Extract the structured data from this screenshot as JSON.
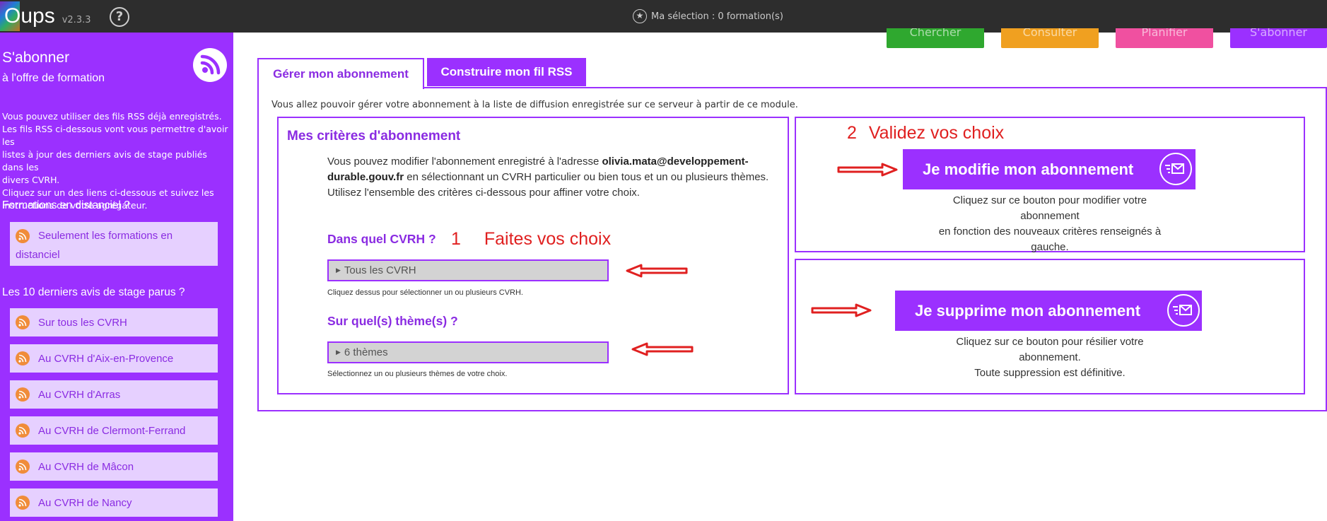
{
  "topbar": {
    "app_name": "Oups",
    "version": "v2.3.3",
    "help_glyph": "?",
    "selection_text": "Ma sélection : 0 formation(s)",
    "buttons": [
      {
        "label": "Chercher",
        "color": "#2fa82f"
      },
      {
        "label": "Consulter",
        "color": "#f0a020"
      },
      {
        "label": "Planifier",
        "color": "#f050a0"
      },
      {
        "label": "S'abonner",
        "color": "#9b30ff"
      }
    ]
  },
  "sidebar": {
    "title": "S'abonner",
    "subtitle": "à l'offre de formation",
    "intro_lines": [
      "Vous pouvez utiliser des fils RSS déjà enregistrés.",
      "Les fils RSS ci-dessous vont vous permettre d'avoir les",
      "listes à jour des derniers avis de stage publiés dans les",
      "divers CVRH.",
      "Cliquez sur un des liens ci-dessous et suivez les",
      "instructions de votre agrégateur."
    ],
    "section_distanciel": "Formations en distanciel ?",
    "item_distanciel_line1": "Seulement les formations en",
    "item_distanciel_line2": "distanciel",
    "section_avis": "Les 10 derniers avis de stage parus ?",
    "items": [
      {
        "label": "Sur tous les CVRH"
      },
      {
        "label": "Au CVRH d'Aix-en-Provence"
      },
      {
        "label": "Au CVRH d'Arras"
      },
      {
        "label": "Au CVRH de Clermont-Ferrand"
      },
      {
        "label": "Au CVRH de Mâcon"
      },
      {
        "label": "Au CVRH de Nancy"
      }
    ]
  },
  "tabs": {
    "active": "Gérer mon abonnement",
    "inactive": "Construire mon fil RSS"
  },
  "main": {
    "intro": "Vous allez pouvoir gérer votre abonnement à la liste de diffusion enregistrée sur ce serveur à partir de ce module.",
    "criteria": {
      "title": "Mes critères d'abonnement",
      "text_before_email": "Vous pouvez modifier l'abonnement enregistré à l'adresse",
      "email_part1": "olivia.mata@developpement-",
      "email_part2": "durable.gouv.fr",
      "text_after_email": "en sélectionnant un CVRH particulier ou bien tous et un ou plusieurs thèmes.",
      "text_line2": "Utilisez l'ensemble des critères ci-dessous pour affiner votre choix.",
      "q_cvrh": "Dans quel CVRH ?",
      "dropdown_cvrh": "Tous les CVRH",
      "hint_cvrh": "Cliquez dessus pour sélectionner un ou plusieurs CVRH.",
      "q_themes": "Sur quel(s) thème(s) ?",
      "dropdown_themes": "6 thèmes",
      "hint_themes": "Sélectionnez un ou plusieurs thèmes de votre choix."
    },
    "modify": {
      "button": "Je modifie mon abonnement",
      "desc_line1": "Cliquez sur ce bouton pour modifier votre abonnement",
      "desc_line2": "en fonction des nouveaux critères renseignés à gauche."
    },
    "delete": {
      "button": "Je supprime mon abonnement",
      "desc_line1": "Cliquez sur ce bouton pour résilier votre abonnement.",
      "desc_line2": "Toute suppression est définitive."
    }
  },
  "annotations": {
    "step1_number": "1",
    "step1_text": "Faites vos choix",
    "step2_number": "2",
    "step2_text": "Validez vos choix",
    "color": "#e02020"
  },
  "colors": {
    "accent": "#9b30ff",
    "accent_text": "#8a2be2",
    "sidebar_item_bg": "#e6d0ff",
    "rss_orange": "#f08c3a"
  }
}
